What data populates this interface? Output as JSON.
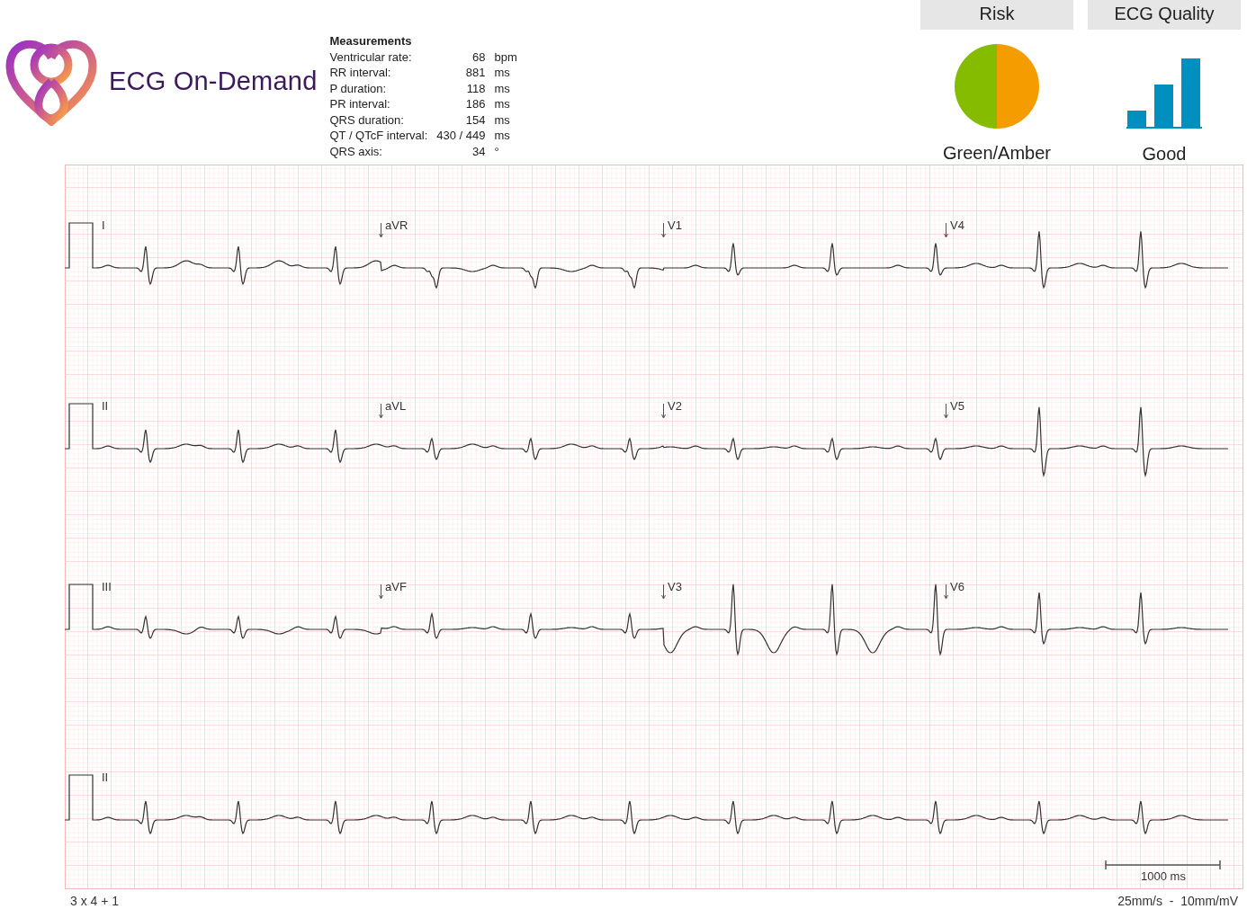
{
  "brand": {
    "name": "ECG On-Demand"
  },
  "measurements": {
    "title": "Measurements",
    "rows": [
      {
        "label": "Ventricular rate:",
        "value": "68",
        "unit": "bpm"
      },
      {
        "label": "RR interval:",
        "value": "881",
        "unit": "ms"
      },
      {
        "label": "P duration:",
        "value": "118",
        "unit": "ms"
      },
      {
        "label": "PR interval:",
        "value": "186",
        "unit": "ms"
      },
      {
        "label": "QRS duration:",
        "value": "154",
        "unit": "ms"
      },
      {
        "label": "QT / QTcF interval:",
        "value": "430 / 449",
        "unit": "ms"
      },
      {
        "label": "QRS axis:",
        "value": "34",
        "unit": "°"
      }
    ]
  },
  "panels": [
    {
      "kind": "pie",
      "title": "Risk",
      "value": "Green/Amber",
      "segments": [
        {
          "color": "#86bc00"
        },
        {
          "color": "#f59c00"
        }
      ]
    },
    {
      "kind": "bars",
      "title": "ECG Quality",
      "value": "Good"
    }
  ],
  "ecg": {
    "rows": [
      {
        "leads": [
          "I",
          "aVR",
          "V1",
          "V4"
        ]
      },
      {
        "leads": [
          "II",
          "aVL",
          "V2",
          "V5"
        ]
      },
      {
        "leads": [
          "III",
          "aVF",
          "V3",
          "V6"
        ]
      },
      {
        "leads": [
          "II"
        ]
      }
    ],
    "scale_bar": "1000 ms"
  },
  "footer": {
    "layout": "3 x 4 + 1",
    "settings": "25mm/s  -  10mm/mV"
  }
}
